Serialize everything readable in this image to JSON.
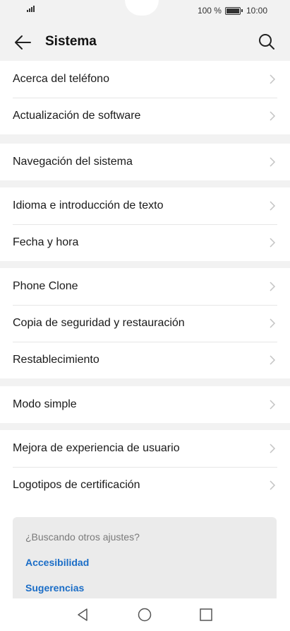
{
  "status": {
    "battery_text": "100 %",
    "time": "10:00"
  },
  "header": {
    "title": "Sistema",
    "back_icon": "arrow-left-icon",
    "search_icon": "search-icon"
  },
  "groups": [
    {
      "items": [
        {
          "label": "Acerca del teléfono"
        },
        {
          "label": "Actualización de software"
        }
      ]
    },
    {
      "items": [
        {
          "label": "Navegación del sistema"
        }
      ]
    },
    {
      "items": [
        {
          "label": "Idioma e introducción de texto"
        },
        {
          "label": "Fecha y hora"
        }
      ]
    },
    {
      "items": [
        {
          "label": "Phone Clone"
        },
        {
          "label": "Copia de seguridad y restauración"
        },
        {
          "label": "Restablecimiento"
        }
      ]
    },
    {
      "items": [
        {
          "label": "Modo simple"
        }
      ]
    },
    {
      "items": [
        {
          "label": "Mejora de experiencia de usuario"
        },
        {
          "label": "Logotipos de certificación"
        }
      ]
    }
  ],
  "suggestions": {
    "question": "¿Buscando otros ajustes?",
    "links": [
      {
        "label": "Accesibilidad"
      },
      {
        "label": "Sugerencias"
      }
    ]
  },
  "navbar": {
    "back_icon": "triangle-back-icon",
    "home_icon": "circle-home-icon",
    "recents_icon": "square-recents-icon"
  },
  "colors": {
    "background": "#f2f2f2",
    "link": "#1a6dc7"
  }
}
